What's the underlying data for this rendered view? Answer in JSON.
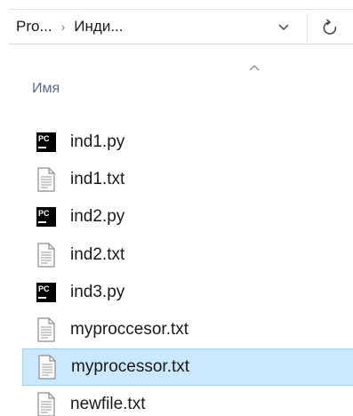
{
  "address_bar": {
    "crumbs": [
      "Pro...",
      "Инди..."
    ],
    "separator": "›"
  },
  "column_header": {
    "name_label": "Имя"
  },
  "files": [
    {
      "name": "ind1.py",
      "icon": "pycharm-file-icon",
      "selected": false
    },
    {
      "name": "ind1.txt",
      "icon": "text-file-icon",
      "selected": false
    },
    {
      "name": "ind2.py",
      "icon": "pycharm-file-icon",
      "selected": false
    },
    {
      "name": "ind2.txt",
      "icon": "text-file-icon",
      "selected": false
    },
    {
      "name": "ind3.py",
      "icon": "pycharm-file-icon",
      "selected": false
    },
    {
      "name": "myproccesor.txt",
      "icon": "text-file-icon",
      "selected": false
    },
    {
      "name": "myprocessor.txt",
      "icon": "text-file-icon",
      "selected": true
    },
    {
      "name": "newfile.txt",
      "icon": "text-file-icon",
      "selected": false
    }
  ],
  "icons": {
    "pycharm_badge_text": "PC"
  },
  "colors": {
    "selection_bg": "#cce8ff",
    "selection_border": "#99d1ff",
    "header_text": "#5b6b8c"
  }
}
